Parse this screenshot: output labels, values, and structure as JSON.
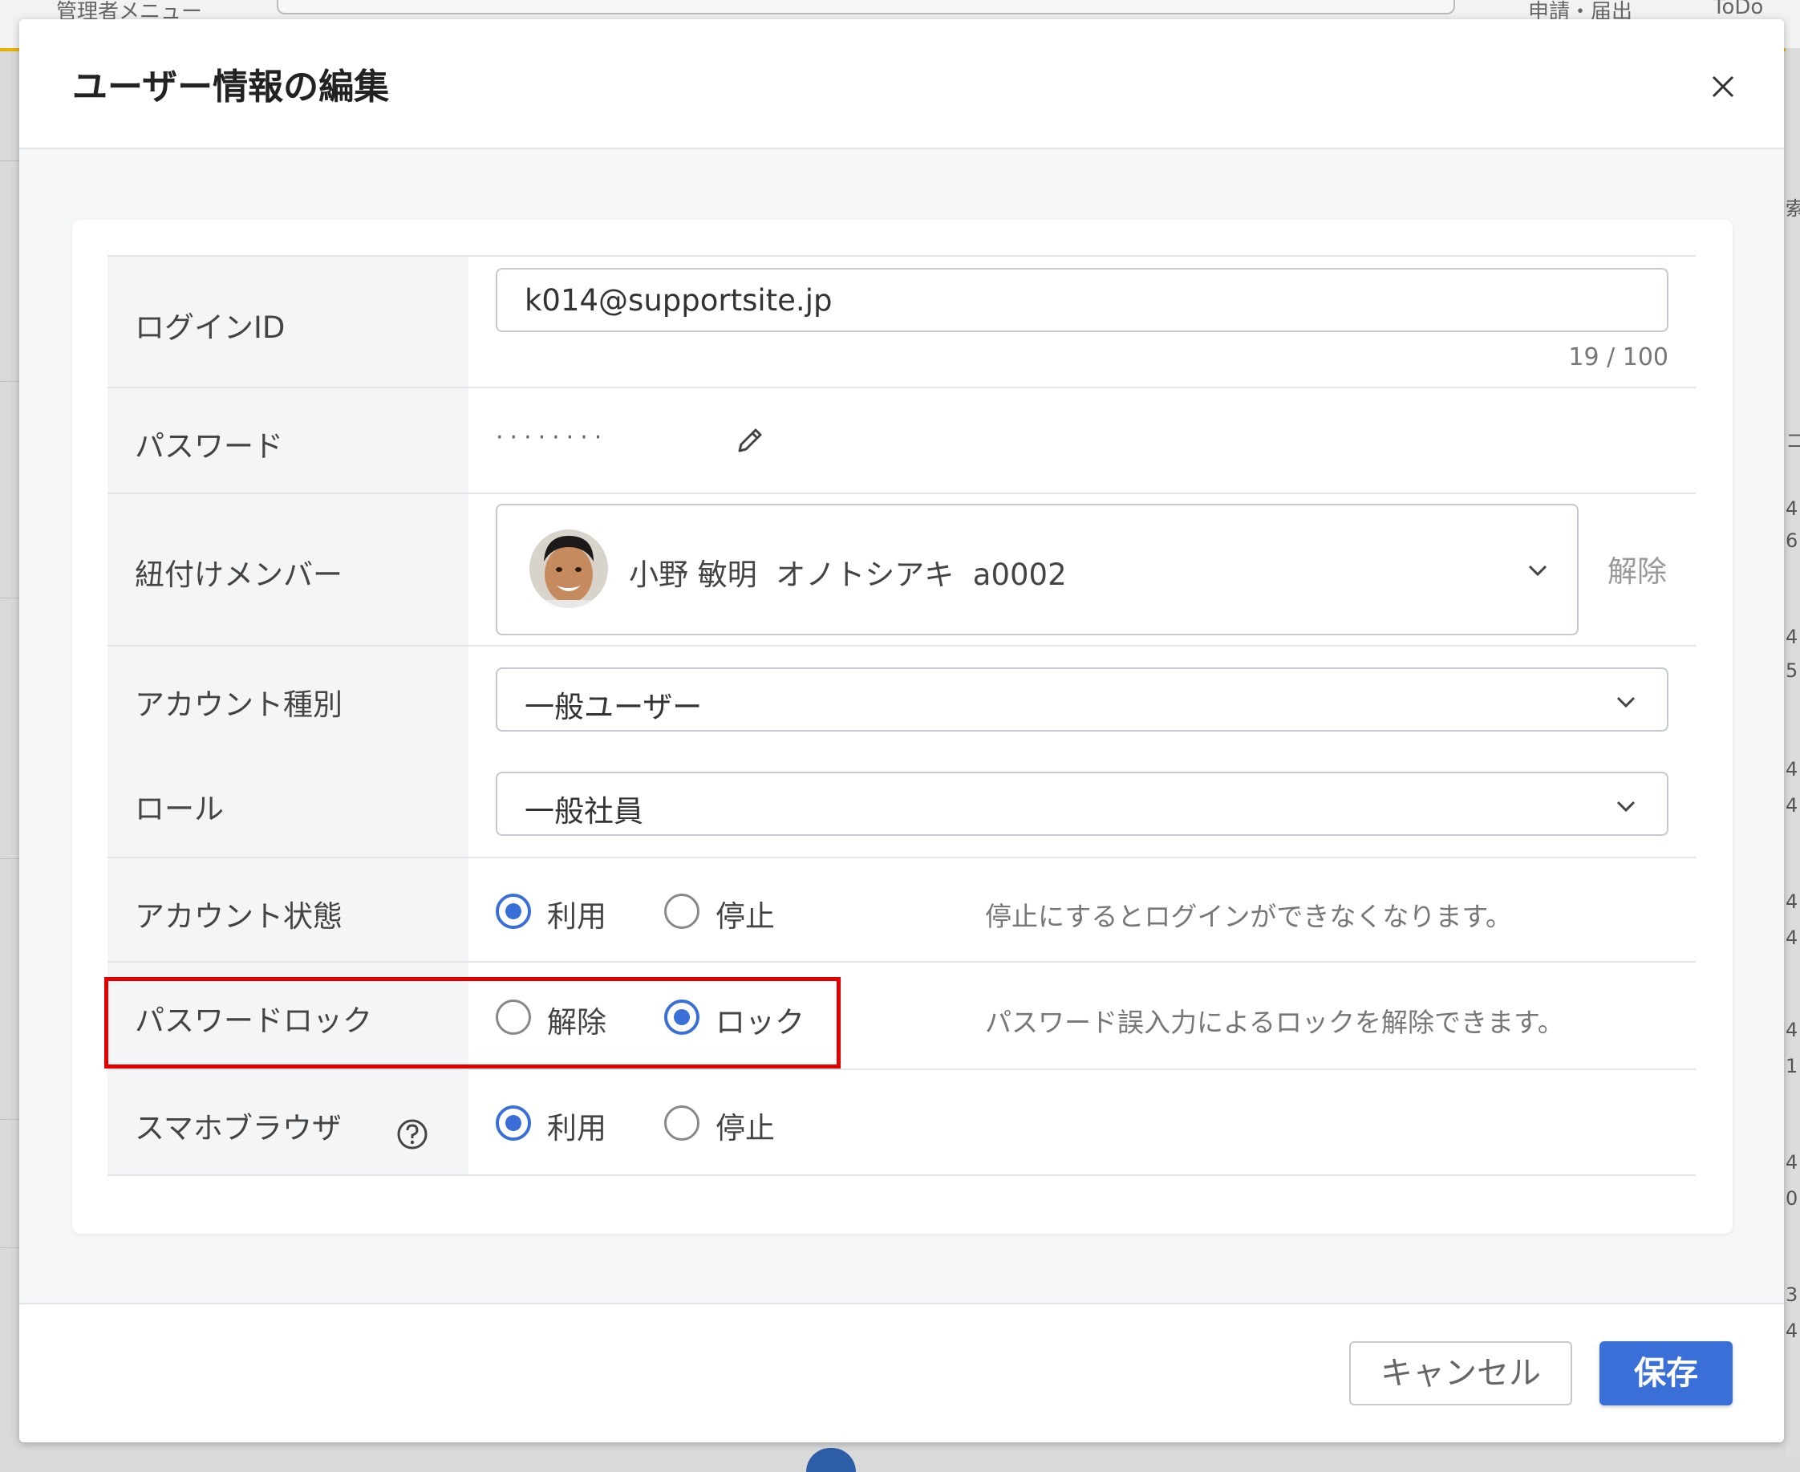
{
  "background": {
    "admin_menu": "管理者メニュー",
    "apply_menu": "申請・届出",
    "todo_menu": "ToDo",
    "right_edge_fragments": [
      "索",
      "コ",
      "4",
      "6",
      "4",
      "5",
      "4",
      "4",
      "4",
      "4",
      "4",
      "1",
      "4",
      "0",
      "3",
      "4"
    ]
  },
  "modal": {
    "title": "ユーザー情報の編集",
    "close_icon": "close-icon",
    "login_id": {
      "label": "ログインID",
      "value": "k014@supportsite.jp",
      "counter": "19 / 100"
    },
    "password": {
      "label": "パスワード",
      "masked": "········",
      "edit_icon": "pencil-icon"
    },
    "member": {
      "label": "紐付けメンバー",
      "value": "小野 敏明  オノトシアキ  a0002",
      "unlink": "解除"
    },
    "account_type": {
      "label": "アカウント種別",
      "value": "一般ユーザー"
    },
    "role": {
      "label": "ロール",
      "value": "一般社員"
    },
    "account_status": {
      "label": "アカウント状態",
      "options": [
        "利用",
        "停止"
      ],
      "selected": "利用",
      "hint": "停止にするとログインができなくなります。"
    },
    "password_lock": {
      "label": "パスワードロック",
      "options": [
        "解除",
        "ロック"
      ],
      "selected": "ロック",
      "hint": "パスワード誤入力によるロックを解除できます。"
    },
    "smartphone_browser": {
      "label": "スマホブラウザ",
      "help_icon": "help-circle-icon",
      "options": [
        "利用",
        "停止"
      ],
      "selected": "利用"
    },
    "footer": {
      "cancel": "キャンセル",
      "save": "保存"
    }
  },
  "colors": {
    "accent": "#3a6fd8",
    "highlight": "#e50000"
  }
}
